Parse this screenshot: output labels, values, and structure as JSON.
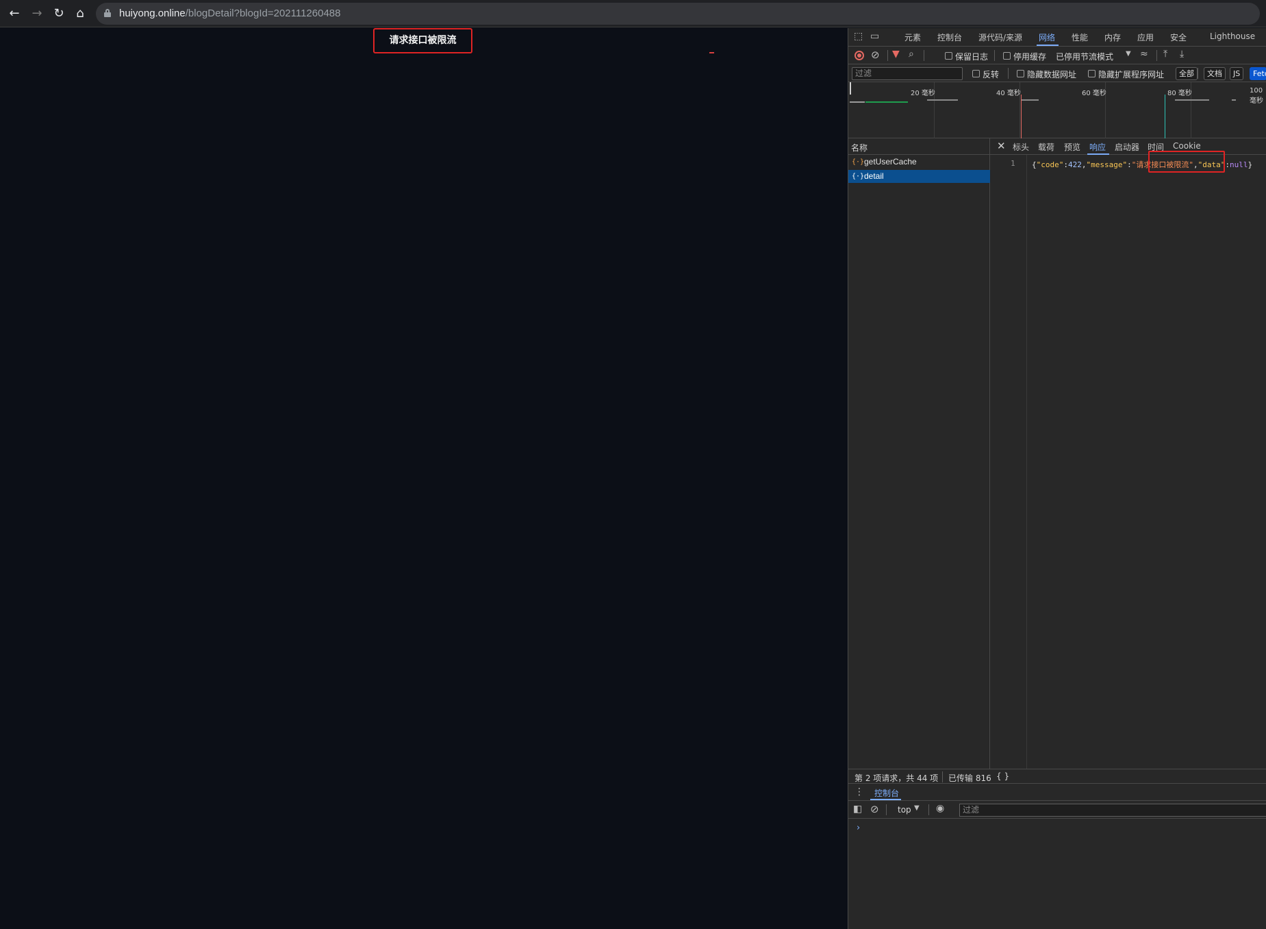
{
  "browser": {
    "url_host": "huiyong.online",
    "url_path": "/blogDetail?blogId=202111260488"
  },
  "page": {
    "toast_text": "请求接口被限流"
  },
  "devtools": {
    "tabs": [
      "元素",
      "控制台",
      "源代码/来源",
      "网络",
      "性能",
      "内存",
      "应用",
      "安全",
      "Lighthouse"
    ],
    "active_tab": "网络",
    "network_toolbar": {
      "preserve_log": "保留日志",
      "disable_cache": "停用缓存",
      "throttle": "已停用节流模式"
    },
    "filter": {
      "placeholder": "过滤",
      "invert": "反转",
      "hide_data_urls": "隐藏数据网址",
      "hide_ext_urls": "隐藏扩展程序网址",
      "types": [
        "全部",
        "文档",
        "JS",
        "Fetch"
      ]
    },
    "overview_labels": [
      "20 毫秒",
      "40 毫秒",
      "60 毫秒",
      "80 毫秒",
      "100 毫秒"
    ],
    "request_list": {
      "header": "名称",
      "items": [
        {
          "name": "getUserCache",
          "selected": false
        },
        {
          "name": "detail",
          "selected": true
        }
      ]
    },
    "detail_tabs": [
      "标头",
      "载荷",
      "预览",
      "响应",
      "启动器",
      "时间",
      "Cookie"
    ],
    "active_detail_tab": "响应",
    "response": {
      "line_number": "1",
      "open_brace": "{",
      "key_code": "\"code\"",
      "colon1": ":",
      "val_code": "422",
      "comma1": ",",
      "key_message": "\"message\"",
      "colon2": ":",
      "val_message": "\"请求接口被限流\"",
      "comma2": ",",
      "key_data": "\"data\"",
      "colon3": ":",
      "val_data": "null",
      "close_brace": "}"
    },
    "status": {
      "requests": "第 2 项请求，共 44 项",
      "transferred": "已传输 816",
      "braces": "{ }"
    },
    "drawer": {
      "tab": "控制台",
      "context": "top",
      "filter_placeholder": "过滤",
      "prompt": "›"
    }
  }
}
